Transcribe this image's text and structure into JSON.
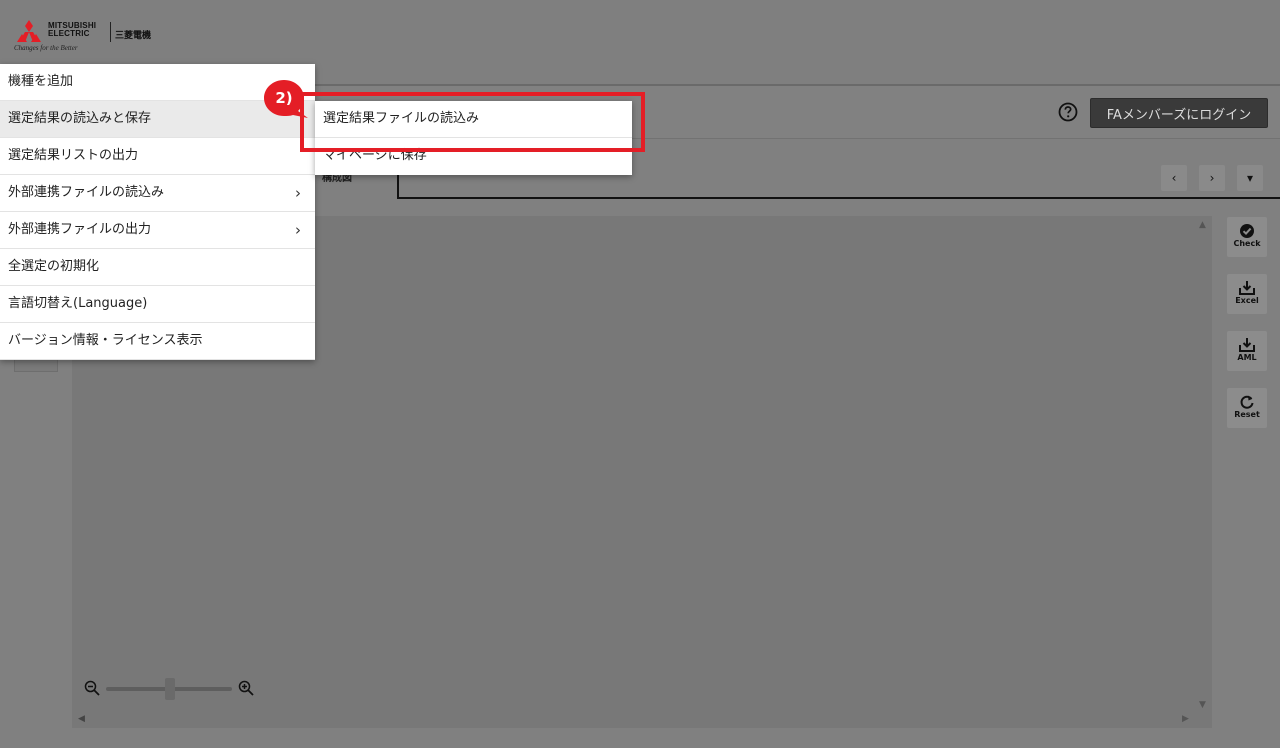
{
  "header": {
    "brand_line1": "MITSUBISHI",
    "brand_line2": "ELECTRIC",
    "brand_jp": "三菱電機",
    "tagline": "Changes for the Better"
  },
  "toolbar": {
    "login_label": "FAメンバーズにログイン",
    "help_icon": "question-circle-icon"
  },
  "tab": {
    "partial_label": "構成図"
  },
  "menu": {
    "items": [
      {
        "label": "機種を追加",
        "has_submenu": false
      },
      {
        "label": "選定結果の読込みと保存",
        "has_submenu": false,
        "active": true
      },
      {
        "label": "選定結果リストの出力",
        "has_submenu": false
      },
      {
        "label": "外部連携ファイルの読込み",
        "has_submenu": true
      },
      {
        "label": "外部連携ファイルの出力",
        "has_submenu": true
      },
      {
        "label": "全選定の初期化",
        "has_submenu": false
      },
      {
        "label": "言語切替え(Language)",
        "has_submenu": false
      },
      {
        "label": "バージョン情報・ライセンス表示",
        "has_submenu": false
      }
    ],
    "chevron": "›"
  },
  "submenu": {
    "items": [
      {
        "label": "選定結果ファイルの読込み"
      },
      {
        "label": "マイページに保存"
      }
    ]
  },
  "nav": {
    "prev": "‹",
    "next": "›",
    "more": "▾"
  },
  "tools": {
    "check": "Check",
    "excel": "Excel",
    "aml": "AML",
    "reset": "Reset"
  },
  "annotation": {
    "step_label": "2)",
    "highlight_color": "#e41e26"
  },
  "scroll": {
    "up": "▲",
    "down": "▼",
    "left": "◀",
    "right": "▶"
  }
}
